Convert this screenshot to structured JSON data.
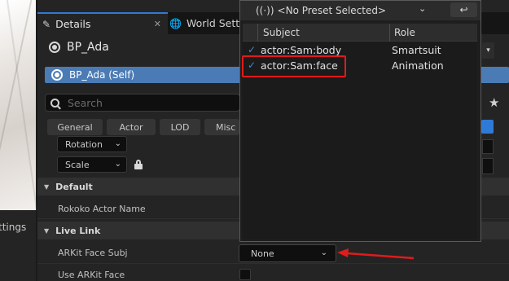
{
  "left": {
    "settings_label": "ttings"
  },
  "tabs": {
    "details": "Details",
    "world": "World Sett"
  },
  "actor": {
    "name": "BP_Ada",
    "self_row": "BP_Ada (Self)"
  },
  "search": {
    "placeholder": "Search"
  },
  "categories": [
    "General",
    "Actor",
    "LOD",
    "Misc"
  ],
  "transform": {
    "rotation": "Rotation",
    "scale": "Scale"
  },
  "sections": {
    "default": "Default",
    "live_link": "Live Link"
  },
  "properties": {
    "rokoko_actor_name": "Rokoko Actor Name",
    "arkit_face_subj": "ARKit Face Subj",
    "use_arkit_face": "Use ARKit Face",
    "arkit_face_value": "None"
  },
  "popup": {
    "preset": "<No Preset Selected>",
    "headers": {
      "subject": "Subject",
      "role": "Role"
    },
    "rows": [
      {
        "subject": "actor:Sam:body",
        "role": "Smartsuit",
        "checked": true
      },
      {
        "subject": "actor:Sam:face",
        "role": "Animation",
        "checked": true
      }
    ]
  },
  "colors": {
    "accent": "#2f7ad6",
    "selection": "#4b7bb5",
    "annotation": "#e01b1b"
  }
}
